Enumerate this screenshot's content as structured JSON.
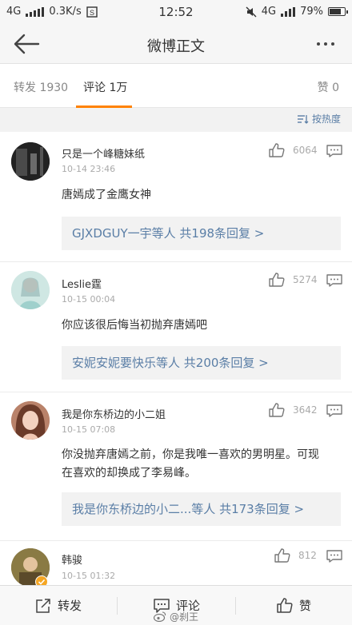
{
  "status": {
    "network_left": "4G",
    "speed": "0.3K/s",
    "time": "12:52",
    "network_right": "4G",
    "battery": "79%"
  },
  "nav": {
    "title": "微博正文"
  },
  "tabs": {
    "repost": "转发 1930",
    "comment": "评论 1万",
    "like": "赞 0"
  },
  "sort": {
    "label": "按热度"
  },
  "comments": [
    {
      "user": "只是一个峰糖妹纸",
      "time": "10-14 23:46",
      "likes": "6064",
      "text": "唐嫣成了金鹰女神",
      "replies": "GJXDGUY一宇等人 共198条回复 >"
    },
    {
      "user": "Leslie霆",
      "time": "10-15 00:04",
      "likes": "5274",
      "text": "你应该很后悔当初抛弃唐嫣吧",
      "replies": "安妮安妮要快乐等人 共200条回复 >"
    },
    {
      "user": "我是你东桥边的小二姐",
      "time": "10-15 07:08",
      "likes": "3642",
      "text": "你没抛弃唐嫣之前，你是我唯一喜欢的男明星。可现在喜欢的却换成了李易峰。",
      "replies": "我是你东桥边的小二...等人 共173条回复 >"
    },
    {
      "user": "韩骏",
      "time": "10-15 01:32",
      "likes": "812",
      "text": "",
      "replies": ""
    }
  ],
  "bottom": {
    "repost": "转发",
    "comment": "评论",
    "like": "赞"
  },
  "watermark": {
    "text": "@刹王"
  },
  "colors": {
    "accent": "#ff8200",
    "link": "#5a7ea6"
  }
}
